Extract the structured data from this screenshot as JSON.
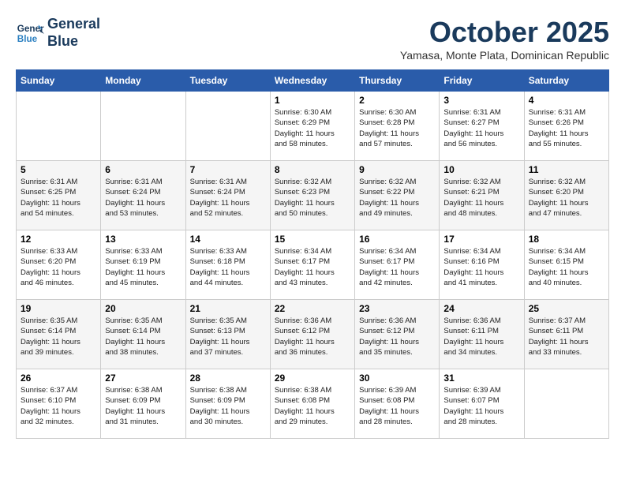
{
  "header": {
    "logo_line1": "General",
    "logo_line2": "Blue",
    "month": "October 2025",
    "location": "Yamasa, Monte Plata, Dominican Republic"
  },
  "weekdays": [
    "Sunday",
    "Monday",
    "Tuesday",
    "Wednesday",
    "Thursday",
    "Friday",
    "Saturday"
  ],
  "weeks": [
    [
      {
        "day": "",
        "info": ""
      },
      {
        "day": "",
        "info": ""
      },
      {
        "day": "",
        "info": ""
      },
      {
        "day": "1",
        "info": "Sunrise: 6:30 AM\nSunset: 6:29 PM\nDaylight: 11 hours\nand 58 minutes."
      },
      {
        "day": "2",
        "info": "Sunrise: 6:30 AM\nSunset: 6:28 PM\nDaylight: 11 hours\nand 57 minutes."
      },
      {
        "day": "3",
        "info": "Sunrise: 6:31 AM\nSunset: 6:27 PM\nDaylight: 11 hours\nand 56 minutes."
      },
      {
        "day": "4",
        "info": "Sunrise: 6:31 AM\nSunset: 6:26 PM\nDaylight: 11 hours\nand 55 minutes."
      }
    ],
    [
      {
        "day": "5",
        "info": "Sunrise: 6:31 AM\nSunset: 6:25 PM\nDaylight: 11 hours\nand 54 minutes."
      },
      {
        "day": "6",
        "info": "Sunrise: 6:31 AM\nSunset: 6:24 PM\nDaylight: 11 hours\nand 53 minutes."
      },
      {
        "day": "7",
        "info": "Sunrise: 6:31 AM\nSunset: 6:24 PM\nDaylight: 11 hours\nand 52 minutes."
      },
      {
        "day": "8",
        "info": "Sunrise: 6:32 AM\nSunset: 6:23 PM\nDaylight: 11 hours\nand 50 minutes."
      },
      {
        "day": "9",
        "info": "Sunrise: 6:32 AM\nSunset: 6:22 PM\nDaylight: 11 hours\nand 49 minutes."
      },
      {
        "day": "10",
        "info": "Sunrise: 6:32 AM\nSunset: 6:21 PM\nDaylight: 11 hours\nand 48 minutes."
      },
      {
        "day": "11",
        "info": "Sunrise: 6:32 AM\nSunset: 6:20 PM\nDaylight: 11 hours\nand 47 minutes."
      }
    ],
    [
      {
        "day": "12",
        "info": "Sunrise: 6:33 AM\nSunset: 6:20 PM\nDaylight: 11 hours\nand 46 minutes."
      },
      {
        "day": "13",
        "info": "Sunrise: 6:33 AM\nSunset: 6:19 PM\nDaylight: 11 hours\nand 45 minutes."
      },
      {
        "day": "14",
        "info": "Sunrise: 6:33 AM\nSunset: 6:18 PM\nDaylight: 11 hours\nand 44 minutes."
      },
      {
        "day": "15",
        "info": "Sunrise: 6:34 AM\nSunset: 6:17 PM\nDaylight: 11 hours\nand 43 minutes."
      },
      {
        "day": "16",
        "info": "Sunrise: 6:34 AM\nSunset: 6:17 PM\nDaylight: 11 hours\nand 42 minutes."
      },
      {
        "day": "17",
        "info": "Sunrise: 6:34 AM\nSunset: 6:16 PM\nDaylight: 11 hours\nand 41 minutes."
      },
      {
        "day": "18",
        "info": "Sunrise: 6:34 AM\nSunset: 6:15 PM\nDaylight: 11 hours\nand 40 minutes."
      }
    ],
    [
      {
        "day": "19",
        "info": "Sunrise: 6:35 AM\nSunset: 6:14 PM\nDaylight: 11 hours\nand 39 minutes."
      },
      {
        "day": "20",
        "info": "Sunrise: 6:35 AM\nSunset: 6:14 PM\nDaylight: 11 hours\nand 38 minutes."
      },
      {
        "day": "21",
        "info": "Sunrise: 6:35 AM\nSunset: 6:13 PM\nDaylight: 11 hours\nand 37 minutes."
      },
      {
        "day": "22",
        "info": "Sunrise: 6:36 AM\nSunset: 6:12 PM\nDaylight: 11 hours\nand 36 minutes."
      },
      {
        "day": "23",
        "info": "Sunrise: 6:36 AM\nSunset: 6:12 PM\nDaylight: 11 hours\nand 35 minutes."
      },
      {
        "day": "24",
        "info": "Sunrise: 6:36 AM\nSunset: 6:11 PM\nDaylight: 11 hours\nand 34 minutes."
      },
      {
        "day": "25",
        "info": "Sunrise: 6:37 AM\nSunset: 6:11 PM\nDaylight: 11 hours\nand 33 minutes."
      }
    ],
    [
      {
        "day": "26",
        "info": "Sunrise: 6:37 AM\nSunset: 6:10 PM\nDaylight: 11 hours\nand 32 minutes."
      },
      {
        "day": "27",
        "info": "Sunrise: 6:38 AM\nSunset: 6:09 PM\nDaylight: 11 hours\nand 31 minutes."
      },
      {
        "day": "28",
        "info": "Sunrise: 6:38 AM\nSunset: 6:09 PM\nDaylight: 11 hours\nand 30 minutes."
      },
      {
        "day": "29",
        "info": "Sunrise: 6:38 AM\nSunset: 6:08 PM\nDaylight: 11 hours\nand 29 minutes."
      },
      {
        "day": "30",
        "info": "Sunrise: 6:39 AM\nSunset: 6:08 PM\nDaylight: 11 hours\nand 28 minutes."
      },
      {
        "day": "31",
        "info": "Sunrise: 6:39 AM\nSunset: 6:07 PM\nDaylight: 11 hours\nand 28 minutes."
      },
      {
        "day": "",
        "info": ""
      }
    ]
  ]
}
